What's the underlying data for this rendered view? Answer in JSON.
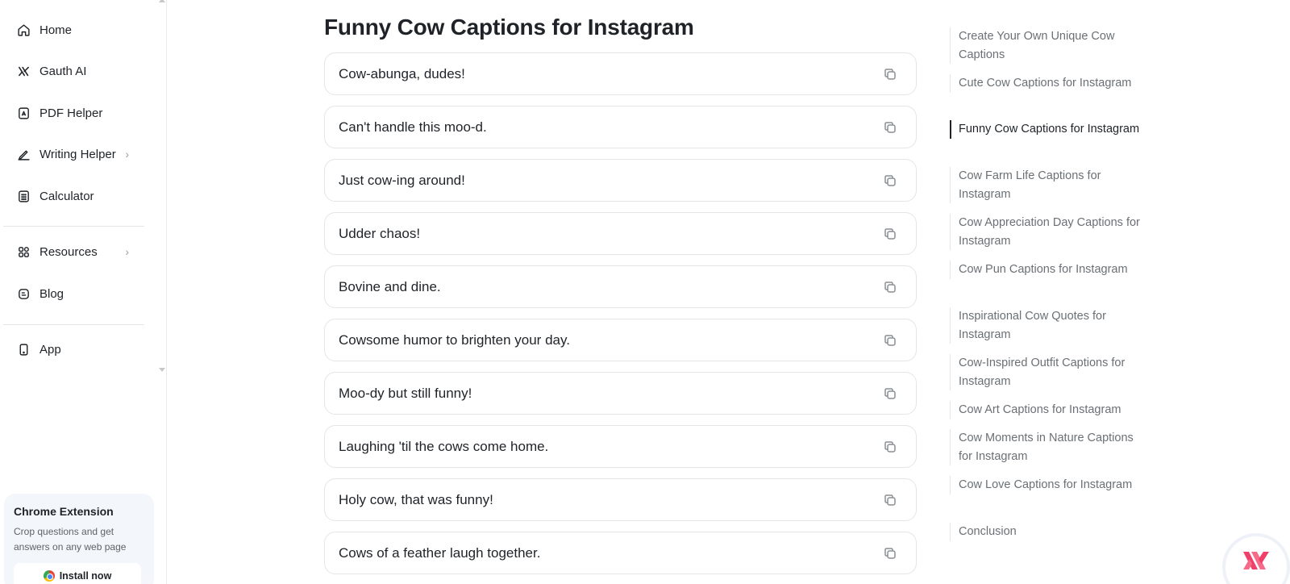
{
  "sidebar": {
    "items": [
      {
        "label": "Home",
        "icon": "home-icon"
      },
      {
        "label": "Gauth AI",
        "icon": "gauth-ai-icon"
      },
      {
        "label": "PDF Helper",
        "icon": "pdf-icon"
      },
      {
        "label": "Writing Helper",
        "icon": "pen-icon"
      },
      {
        "label": "Calculator",
        "icon": "calculator-icon"
      },
      {
        "label": "Resources",
        "icon": "grid-icon"
      },
      {
        "label": "Blog",
        "icon": "blog-icon"
      },
      {
        "label": "App",
        "icon": "phone-icon"
      }
    ],
    "extension": {
      "title": "Chrome Extension",
      "description": "Crop questions and get answers on any web page",
      "install_label": "Install now"
    }
  },
  "main": {
    "title": "Funny Cow Captions for Instagram",
    "captions": [
      "Cow-abunga, dudes!",
      "Can't handle this moo-d.",
      "Just cow-ing around!",
      "Udder chaos!",
      "Bovine and dine.",
      "Cowsome humor to brighten your day.",
      "Moo-dy but still funny!",
      "Laughing 'til the cows come home.",
      "Holy cow, that was funny!",
      "Cows of a feather laugh together."
    ]
  },
  "toc": {
    "items": [
      "Create Your Own Unique Cow Captions",
      "Cute Cow Captions for Instagram",
      "Funny Cow Captions for Instagram",
      "Cow Farm Life Captions for Instagram",
      "Cow Appreciation Day Captions for Instagram",
      "Cow Pun Captions for Instagram",
      "Inspirational Cow Quotes for Instagram",
      "Cow-Inspired Outfit Captions for Instagram",
      "Cow Art Captions for Instagram",
      "Cow Moments in Nature Captions for Instagram",
      "Cow Love Captions for Instagram",
      "Conclusion"
    ],
    "active_index": 2
  },
  "colors": {
    "text": "#1f2328",
    "muted": "#6b7075",
    "border": "#e3e5e8",
    "accent": "#f0406a"
  }
}
